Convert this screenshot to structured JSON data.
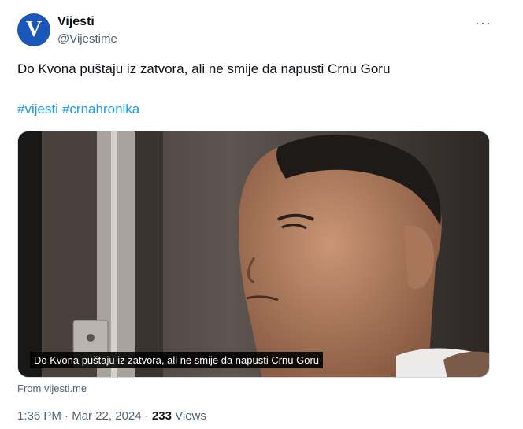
{
  "account": {
    "name": "Vijesti",
    "handle": "@Vijestime",
    "avatar_letter": "V"
  },
  "more_icon": "···",
  "tweet": {
    "text": "Do Kvona puštaju iz zatvora, ali ne smije da napusti Crnu Goru",
    "hashtags": [
      "#vijesti",
      "#crnahronika"
    ]
  },
  "media": {
    "caption": "Do Kvona puštaju iz zatvora, ali ne smije da napusti Crnu Goru"
  },
  "source": "From vijesti.me",
  "meta": {
    "time": "1:36 PM",
    "separator": " · ",
    "date": "Mar 22, 2024",
    "views_count": "233",
    "views_label": " Views"
  },
  "colors": {
    "link": "#1d9bf0",
    "avatar": "#1a57b8",
    "secondary": "#536471"
  }
}
